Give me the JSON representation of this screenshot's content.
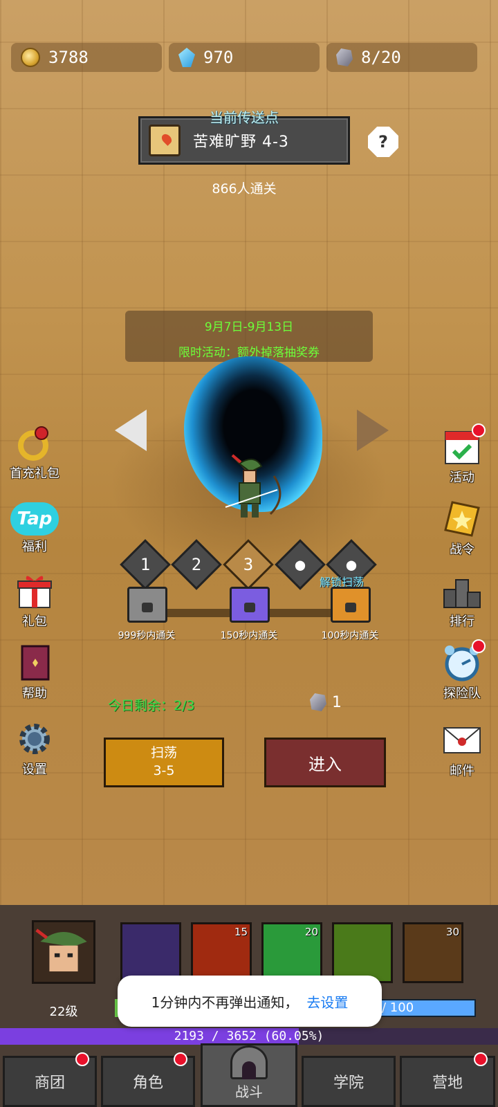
{
  "resources": {
    "gold": "3788",
    "gems": "970",
    "stamina": "8/20"
  },
  "teleport": {
    "title": "当前传送点",
    "stage": "苦难旷野 4-3",
    "help": "?",
    "clear_count": "866人通关"
  },
  "event": {
    "date": "9月7日-9月13日",
    "text": "限时活动：额外掉落抽奖券"
  },
  "left_menu": [
    {
      "label": "首充礼包",
      "icon": "ring-icon"
    },
    {
      "label": "福利",
      "icon": "tap-icon",
      "badge": "Tap"
    },
    {
      "label": "礼包",
      "icon": "gift-icon"
    },
    {
      "label": "帮助",
      "icon": "book-icon"
    },
    {
      "label": "设置",
      "icon": "gear-icon"
    }
  ],
  "right_menu": [
    {
      "label": "活动",
      "icon": "calendar-icon",
      "dot": true
    },
    {
      "label": "战令",
      "icon": "star-badge-icon",
      "dot": false
    },
    {
      "label": "排行",
      "icon": "podium-icon",
      "dot": false
    },
    {
      "label": "探险队",
      "icon": "alarm-clock-icon",
      "dot": true
    },
    {
      "label": "邮件",
      "icon": "envelope-icon",
      "dot": false
    }
  ],
  "difficulty": [
    "1",
    "2",
    "3"
  ],
  "difficulty_selected": "3",
  "unlock_sweep": "解锁扫荡",
  "chests": [
    {
      "label": "999秒内通关",
      "color": "#8a8a8a"
    },
    {
      "label": "150秒内通关",
      "color": "#7b5de0"
    },
    {
      "label": "100秒内通关",
      "color": "#e0912a"
    }
  ],
  "today_sweeps": "今日剩余：2/3",
  "enter_cost": "1",
  "buttons": {
    "sweep_line1": "扫荡",
    "sweep_line2": "3-5",
    "enter": "进入"
  },
  "hero": {
    "level": "22级",
    "mp_text": "/ 100",
    "xp_text": "2193 / 3652 (60.05%)",
    "xp_fraction": 0.6005
  },
  "skills": [
    {
      "name": "dart-skill-icon",
      "level": "",
      "color": "#3a2a6a"
    },
    {
      "name": "crossbow-skill-icon",
      "level": "15",
      "color": "#a02a10"
    },
    {
      "name": "paw-skill-icon",
      "level": "20",
      "color": "#2a9a3a"
    },
    {
      "name": "boot-skill-icon",
      "level": "",
      "color": "#4a7a1a"
    },
    {
      "name": "arrow-rain-skill-icon",
      "level": "30",
      "color": "#5a3a1a"
    }
  ],
  "toast": {
    "text": "1分钟内不再弹出通知，",
    "link": "去设置"
  },
  "nav": {
    "guild": "商团",
    "character": "角色",
    "battle": "战斗",
    "academy": "学院",
    "camp": "营地"
  }
}
